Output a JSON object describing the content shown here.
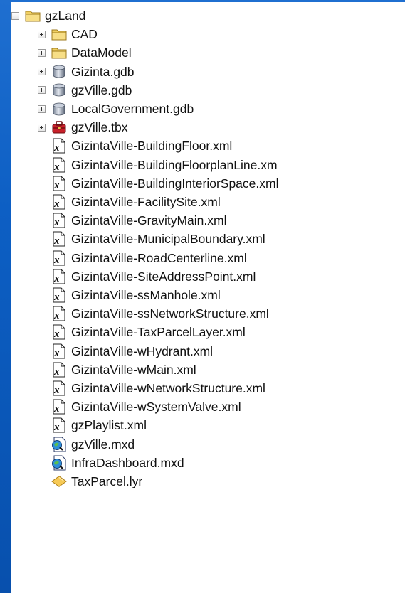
{
  "tree": {
    "root": {
      "label": "gzLand",
      "icon": "folder-icon",
      "expanded": true
    },
    "children": [
      {
        "label": "CAD",
        "icon": "folder-icon",
        "expander": "plus"
      },
      {
        "label": "DataModel",
        "icon": "folder-icon",
        "expander": "plus"
      },
      {
        "label": "Gizinta.gdb",
        "icon": "geodatabase-icon",
        "expander": "plus"
      },
      {
        "label": "gzVille.gdb",
        "icon": "geodatabase-icon",
        "expander": "plus"
      },
      {
        "label": "LocalGovernment.gdb",
        "icon": "geodatabase-icon",
        "expander": "plus"
      },
      {
        "label": "gzVille.tbx",
        "icon": "toolbox-icon",
        "expander": "plus"
      },
      {
        "label": "GizintaVille-BuildingFloor.xml",
        "icon": "xml-file-icon"
      },
      {
        "label": "GizintaVille-BuildingFloorplanLine.xm",
        "icon": "xml-file-icon"
      },
      {
        "label": "GizintaVille-BuildingInteriorSpace.xml",
        "icon": "xml-file-icon"
      },
      {
        "label": "GizintaVille-FacilitySite.xml",
        "icon": "xml-file-icon"
      },
      {
        "label": "GizintaVille-GravityMain.xml",
        "icon": "xml-file-icon"
      },
      {
        "label": "GizintaVille-MunicipalBoundary.xml",
        "icon": "xml-file-icon"
      },
      {
        "label": "GizintaVille-RoadCenterline.xml",
        "icon": "xml-file-icon"
      },
      {
        "label": "GizintaVille-SiteAddressPoint.xml",
        "icon": "xml-file-icon"
      },
      {
        "label": "GizintaVille-ssManhole.xml",
        "icon": "xml-file-icon"
      },
      {
        "label": "GizintaVille-ssNetworkStructure.xml",
        "icon": "xml-file-icon"
      },
      {
        "label": "GizintaVille-TaxParcelLayer.xml",
        "icon": "xml-file-icon"
      },
      {
        "label": "GizintaVille-wHydrant.xml",
        "icon": "xml-file-icon"
      },
      {
        "label": "GizintaVille-wMain.xml",
        "icon": "xml-file-icon"
      },
      {
        "label": "GizintaVille-wNetworkStructure.xml",
        "icon": "xml-file-icon"
      },
      {
        "label": "GizintaVille-wSystemValve.xml",
        "icon": "xml-file-icon"
      },
      {
        "label": "gzPlaylist.xml",
        "icon": "xml-file-icon"
      },
      {
        "label": "gzVille.mxd",
        "icon": "map-document-icon"
      },
      {
        "label": "InfraDashboard.mxd",
        "icon": "map-document-icon"
      },
      {
        "label": "TaxParcel.lyr",
        "icon": "layer-file-icon"
      }
    ]
  }
}
